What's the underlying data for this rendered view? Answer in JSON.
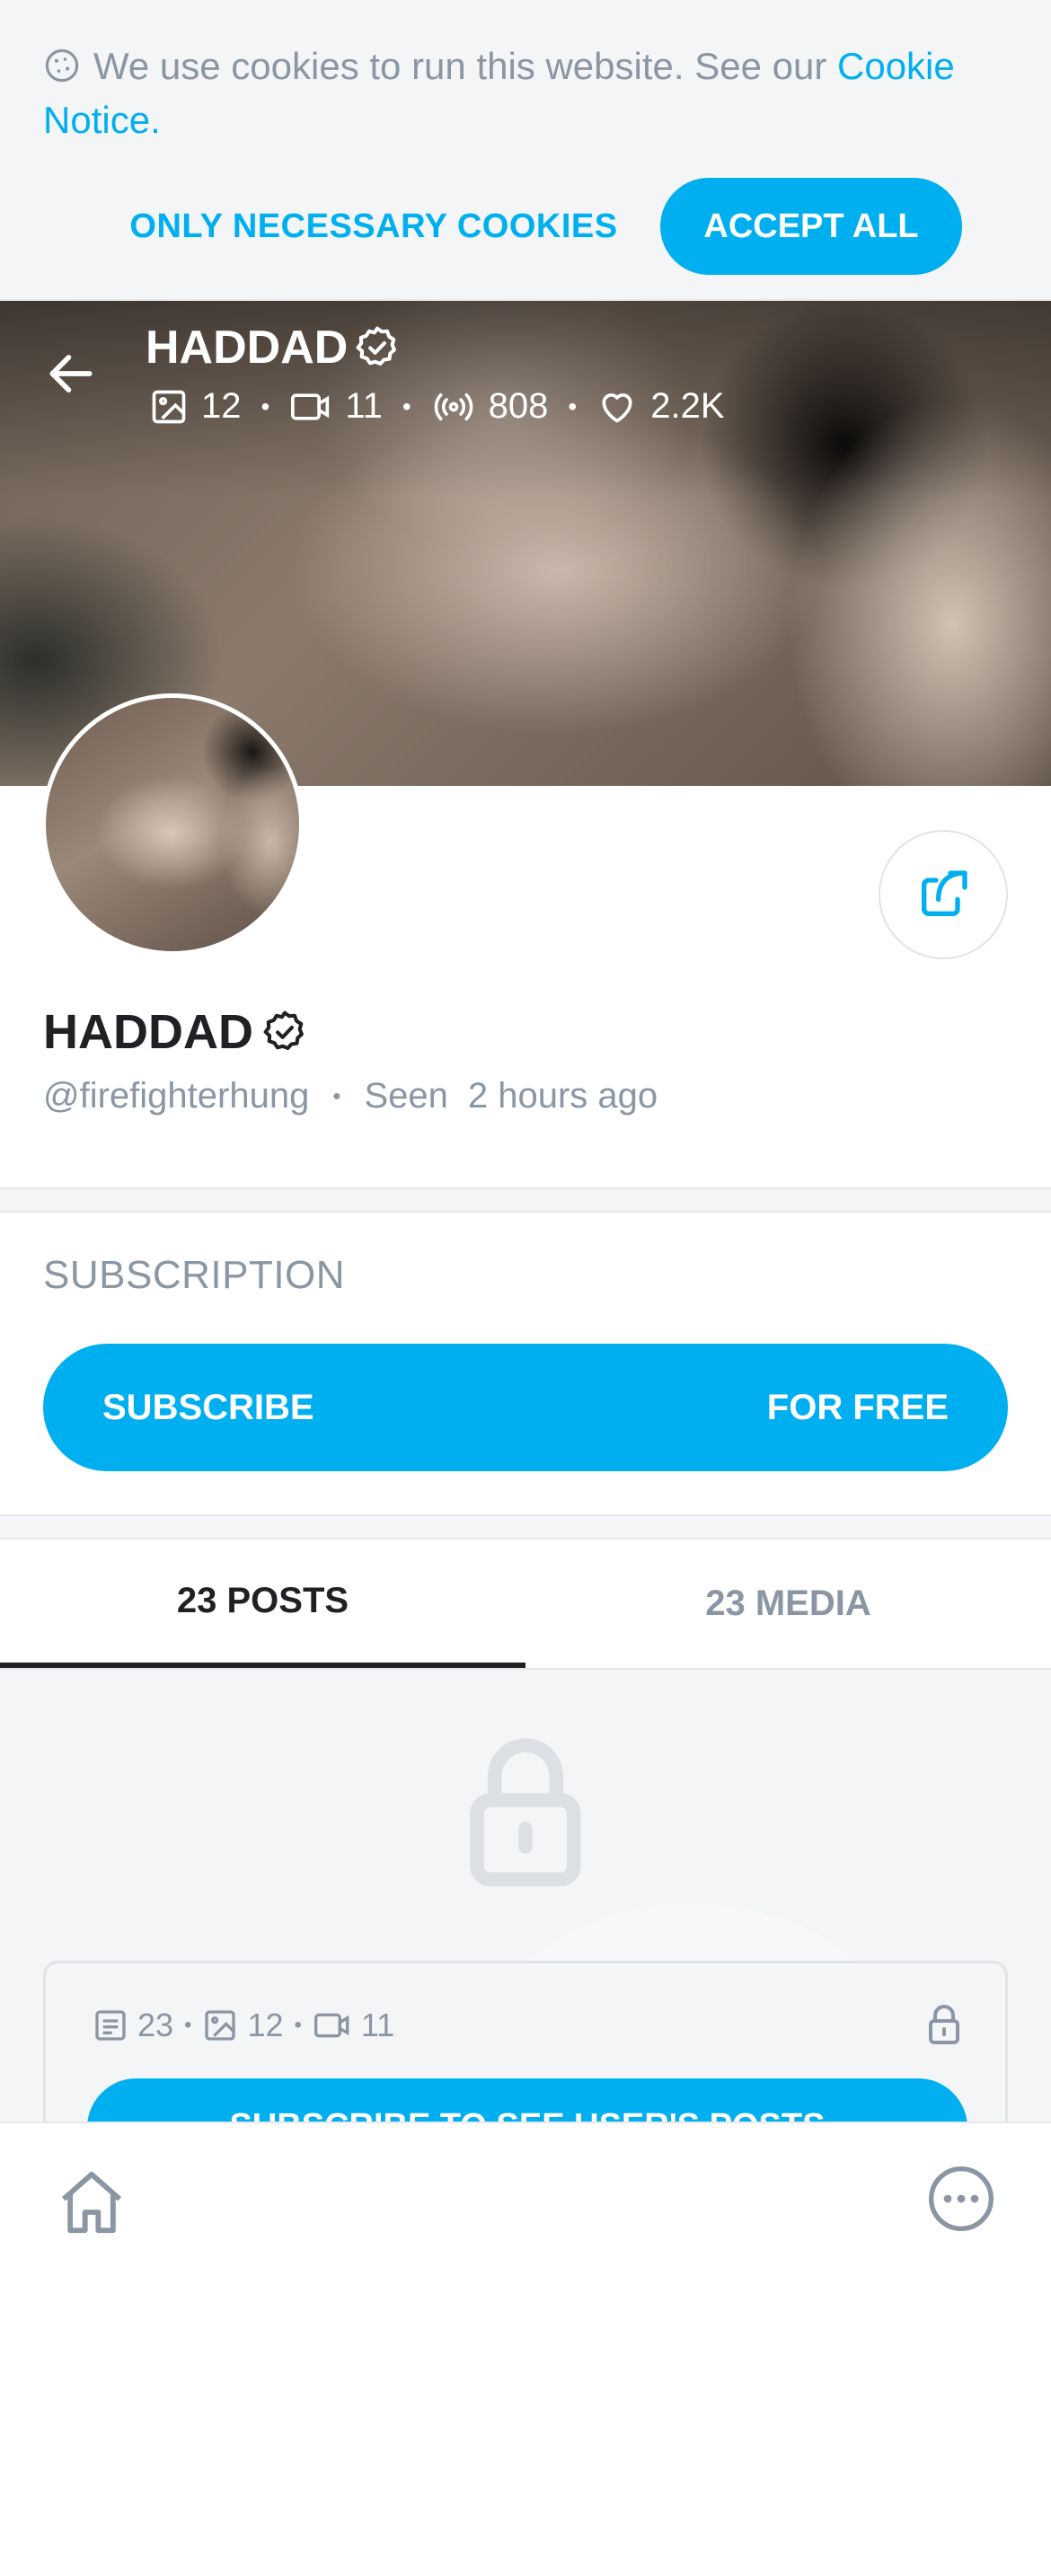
{
  "cookie_banner": {
    "text": "We use cookies to run this website. See our",
    "link": "Cookie Notice",
    "suffix": ".",
    "necessary_label": "ONLY NECESSARY COOKIES",
    "accept_label": "ACCEPT ALL",
    "icon": "cookie-icon"
  },
  "header": {
    "name": "HADDAD",
    "verified_icon": "verified-badge-icon",
    "stats": {
      "photos": "12",
      "videos": "11",
      "streams": "808",
      "likes": "2.2K"
    },
    "separator": "•"
  },
  "profile": {
    "name": "HADDAD",
    "handle": "@firefighterhung",
    "separator": "•",
    "seen_label": "Seen",
    "seen_value": "2 hours ago"
  },
  "subscription": {
    "title": "SUBSCRIPTION",
    "button_left": "SUBSCRIBE",
    "button_right": "FOR FREE"
  },
  "tabs": [
    {
      "label": "23 POSTS",
      "active": true
    },
    {
      "label": "23 MEDIA",
      "active": false
    }
  ],
  "locked_card": {
    "posts": "23",
    "photos": "12",
    "videos": "11",
    "separator": "•",
    "button_label": "SUBSCRIBE TO SEE USER'S POSTS"
  },
  "colors": {
    "accent": "#00aff0",
    "muted": "#8a96a3",
    "dark": "#1f2124",
    "background_gray": "#f4f5f7"
  }
}
